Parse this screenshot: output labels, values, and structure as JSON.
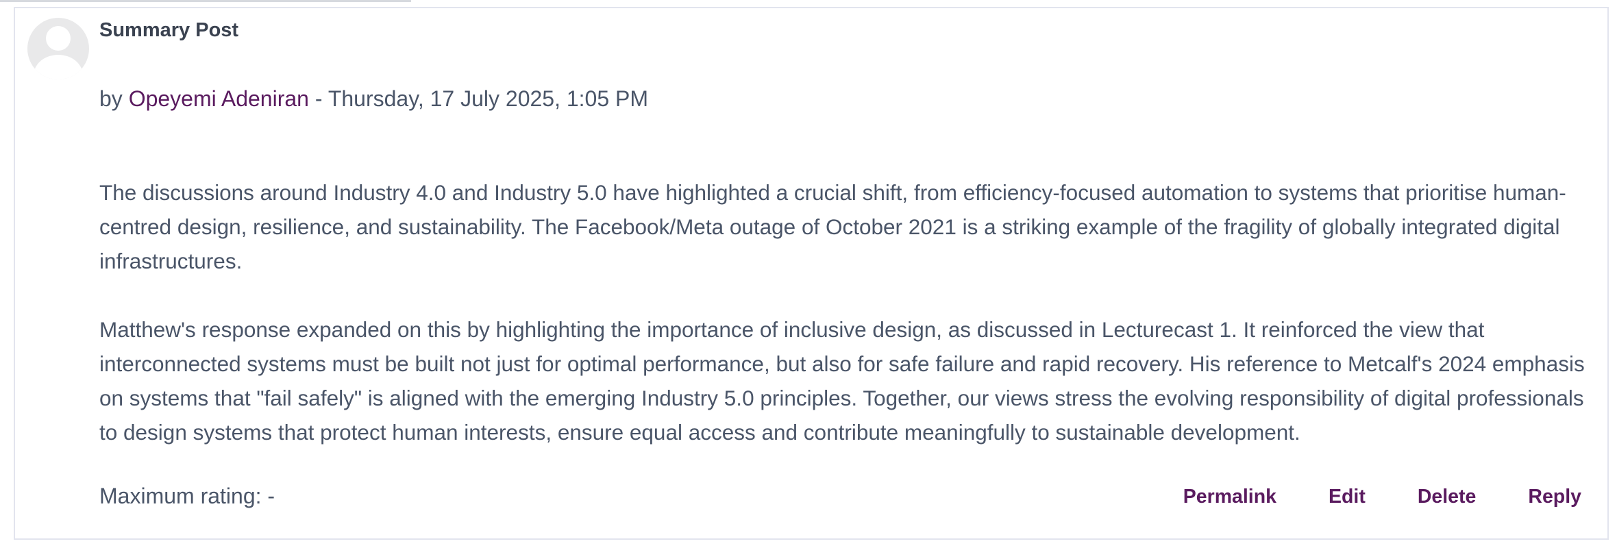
{
  "post": {
    "subject": "Summary Post",
    "byline": {
      "prefix": "by",
      "author": "Opeyemi Adeniran",
      "separator": "-",
      "date": "Thursday, 17 July 2025, 1:05 PM"
    },
    "paragraphs": [
      "The discussions around Industry 4.0 and Industry 5.0 have highlighted a crucial shift, from efficiency-focused automation to systems that prioritise human-centred design, resilience, and sustainability. The Facebook/Meta outage of October 2021 is a striking example of the fragility of globally integrated digital infrastructures.",
      "Matthew's response expanded on this by highlighting the importance of inclusive design, as discussed in Lecturecast 1. It reinforced the view that interconnected systems must be built not just for optimal performance, but also for safe failure and rapid recovery. His reference to Metcalf's 2024 emphasis on systems that \"fail safely\" is aligned with the emerging Industry 5.0 principles. Together, our views stress the evolving responsibility of digital professionals to design systems that protect human interests, ensure equal access and contribute meaningfully to sustainable development."
    ],
    "rating_label": "Maximum rating: -",
    "actions": {
      "permalink": "Permalink",
      "edit": "Edit",
      "delete": "Delete",
      "reply": "Reply"
    }
  },
  "colors": {
    "link": "#5a1b5f",
    "text": "#4a5568",
    "border": "#e2e4ee"
  }
}
